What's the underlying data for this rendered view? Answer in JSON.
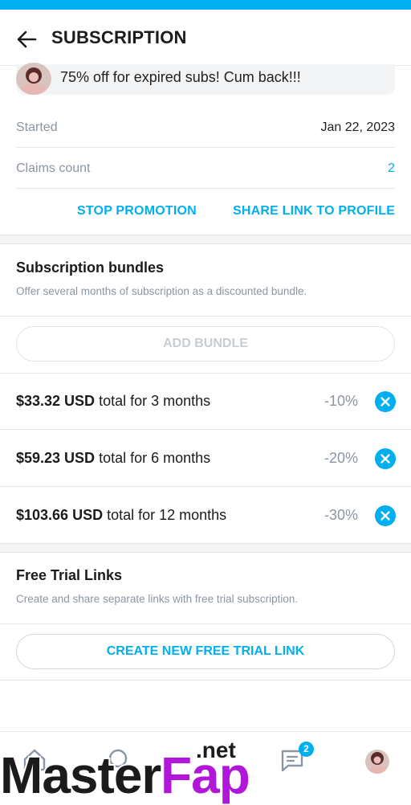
{
  "header": {
    "title": "SUBSCRIPTION"
  },
  "promotion": {
    "message": "75% off for expired subs! Cum back!!!",
    "started_label": "Started",
    "started_value": "Jan 22, 2023",
    "claims_label": "Claims count",
    "claims_value": "2",
    "stop_label": "STOP PROMOTION",
    "share_label": "SHARE LINK TO PROFILE"
  },
  "bundles": {
    "title": "Subscription bundles",
    "description": "Offer several months of subscription as a discounted bundle.",
    "add_label": "ADD BUNDLE",
    "items": [
      {
        "price": "$33.32 USD",
        "suffix": " total for 3 months",
        "discount": "-10%"
      },
      {
        "price": "$59.23 USD",
        "suffix": " total for 6 months",
        "discount": "-20%"
      },
      {
        "price": "$103.66 USD",
        "suffix": " total for 12 months",
        "discount": "-30%"
      }
    ]
  },
  "free_trial": {
    "title": "Free Trial Links",
    "description": "Create and share separate links with free trial subscription.",
    "create_label": "CREATE NEW FREE TRIAL LINK"
  },
  "bottom_nav": {
    "messages_badge": "2",
    "icons": [
      "home-icon",
      "search-icon",
      "messages-icon",
      "profile-avatar"
    ]
  },
  "watermark": {
    "master": "Master",
    "fap": "Fap",
    "net": ".net"
  },
  "colors": {
    "accent": "#00aff0",
    "muted": "#8a96a3",
    "watermark_purple": "#b017d8"
  }
}
